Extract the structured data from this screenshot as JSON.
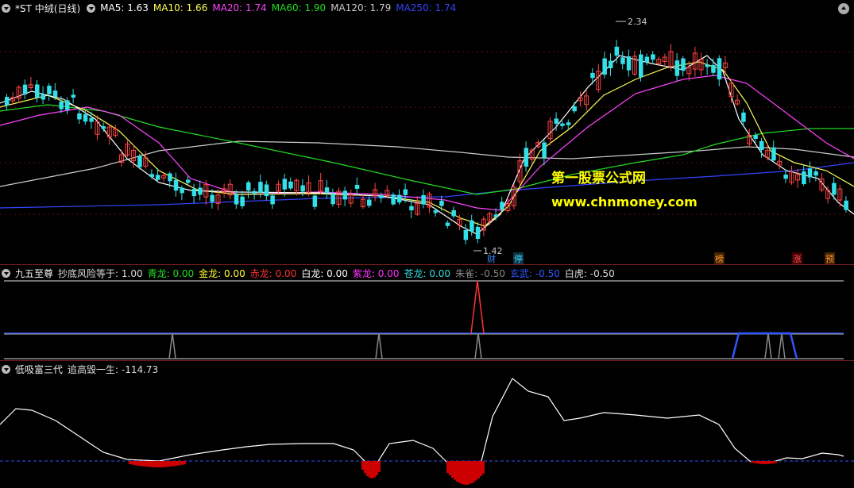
{
  "main": {
    "title": "*ST 中绒(日线)",
    "ma_legend": [
      {
        "label": "MA5: 1.63",
        "color": "#ffffff"
      },
      {
        "label": "MA10: 1.66",
        "color": "#ffff55"
      },
      {
        "label": "MA20: 1.74",
        "color": "#ff44ff"
      },
      {
        "label": "MA60: 1.90",
        "color": "#22dd22"
      },
      {
        "label": "MA120: 1.79",
        "color": "#cccccc"
      },
      {
        "label": "MA250: 1.74",
        "color": "#3344ff"
      }
    ],
    "high_label": "2.34",
    "low_label": "1.42",
    "watermark_title": "第一股票公式网",
    "watermark_url": "www.chnmoney.com",
    "event_tags": [
      {
        "text": "财",
        "color": "#3388ff"
      },
      {
        "text": "停",
        "color": "#33ddff"
      },
      {
        "text": "榜",
        "color": "#ff9933"
      },
      {
        "text": "涨",
        "color": "#ff5555"
      },
      {
        "text": "预",
        "color": "#ff9933"
      }
    ]
  },
  "indicator1": {
    "name": "九五至尊",
    "items": [
      {
        "label": "抄底风险等于: 1.00",
        "color": "#dddddd"
      },
      {
        "label": "青龙: 0.00",
        "color": "#22dd22"
      },
      {
        "label": "金龙: 0.00",
        "color": "#ffff33"
      },
      {
        "label": "赤龙: 0.00",
        "color": "#ff3333"
      },
      {
        "label": "白龙: 0.00",
        "color": "#ffffff"
      },
      {
        "label": "紫龙: 0.00",
        "color": "#ff33ff"
      },
      {
        "label": "苍龙: 0.00",
        "color": "#33dddd"
      },
      {
        "label": "朱雀: -0.50",
        "color": "#888888"
      },
      {
        "label": "玄武: -0.50",
        "color": "#3355ff"
      },
      {
        "label": "白虎: -0.50",
        "color": "#dddddd"
      }
    ]
  },
  "indicator2": {
    "name": "低吸富三代",
    "items": [
      {
        "label": "追高毁一生: -114.73",
        "color": "#dddddd"
      }
    ]
  },
  "colors": {
    "up": "#ff4444",
    "down": "#33e0e8",
    "grid": "#7a1f1f"
  }
}
